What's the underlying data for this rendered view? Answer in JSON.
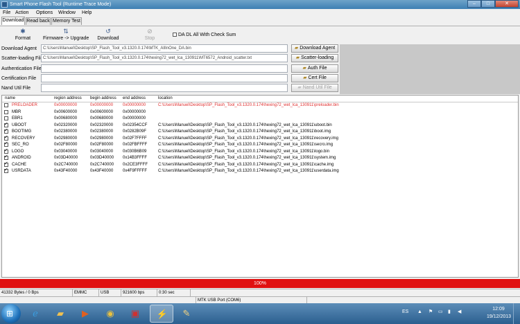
{
  "window": {
    "title": "Smart Phone Flash Tool (Runtime Trace Mode)"
  },
  "menu": [
    "File",
    "Action",
    "Options",
    "Window",
    "Help"
  ],
  "tabs": [
    "Download",
    "Read back",
    "Memory Test"
  ],
  "toolbar": {
    "format": "Format",
    "firmware_upgrade": "Firmware -> Upgrade",
    "download": "Download",
    "stop": "Stop",
    "da_dl_label": "DA DL All With Check Sum"
  },
  "files": [
    {
      "label": "Download Agent",
      "value": "C:\\Users\\Manuel\\Desktop\\SP_Flash_Tool_v3.1320.0.174\\MTK_AllInOne_DA.bin",
      "button": "Download Agent",
      "enabled": true
    },
    {
      "label": "Scatter-loading File",
      "value": "C:\\Users\\Manuel\\Desktop\\SP_Flash_Tool_v3.1320.0.174\\hexing72_wet_lca_130911\\MT6572_Android_scatter.txt",
      "button": "Scatter-loading",
      "enabled": true
    },
    {
      "label": "Authentication File",
      "value": "",
      "button": "Auth File",
      "enabled": true
    },
    {
      "label": "Certification File",
      "value": "",
      "button": "Cert File",
      "enabled": true
    },
    {
      "label": "Nand Util File",
      "value": "",
      "button": "Nand Util File",
      "enabled": false
    }
  ],
  "table": {
    "headers": [
      "name",
      "region address",
      "begin address",
      "end address",
      "location"
    ],
    "rows": [
      {
        "checked": false,
        "name": "PRELOADER",
        "region": "0x00000000",
        "begin": "0x00000000",
        "end": "0x00000000",
        "location": "C:\\Users\\Manuel\\Desktop\\SP_Flash_Tool_v3.1320.0.174\\hexing72_wet_lca_130911\\preloader.bin",
        "highlight": true
      },
      {
        "checked": false,
        "name": "MBR",
        "region": "0x00600000",
        "begin": "0x00600000",
        "end": "0x00000000",
        "location": "",
        "highlight": false
      },
      {
        "checked": false,
        "name": "EBR1",
        "region": "0x00680000",
        "begin": "0x00680000",
        "end": "0x00000000",
        "location": "",
        "highlight": false
      },
      {
        "checked": true,
        "name": "UBOOT",
        "region": "0x02320000",
        "begin": "0x02320000",
        "end": "0x02354CCF",
        "location": "C:\\Users\\Manuel\\Desktop\\SP_Flash_Tool_v3.1320.0.174\\hexing72_wet_lca_130911\\uboot.bin",
        "highlight": false
      },
      {
        "checked": true,
        "name": "BOOTIMG",
        "region": "0x02380000",
        "begin": "0x02380000",
        "end": "0x0282B09F",
        "location": "C:\\Users\\Manuel\\Desktop\\SP_Flash_Tool_v3.1320.0.174\\hexing72_wet_lca_130911\\boot.img",
        "highlight": false
      },
      {
        "checked": true,
        "name": "RECOVERY",
        "region": "0x02980000",
        "begin": "0x02980000",
        "end": "0x02F7FFFF",
        "location": "C:\\Users\\Manuel\\Desktop\\SP_Flash_Tool_v3.1320.0.174\\hexing72_wet_lca_130911\\recovery.img",
        "highlight": false
      },
      {
        "checked": true,
        "name": "SEC_RO",
        "region": "0x02F80000",
        "begin": "0x02F80000",
        "end": "0x02FBFFFF",
        "location": "C:\\Users\\Manuel\\Desktop\\SP_Flash_Tool_v3.1320.0.174\\hexing72_wet_lca_130911\\secro.img",
        "highlight": false
      },
      {
        "checked": true,
        "name": "LOGO",
        "region": "0x03040000",
        "begin": "0x03040000",
        "end": "0x030B6B09",
        "location": "C:\\Users\\Manuel\\Desktop\\SP_Flash_Tool_v3.1320.0.174\\hexing72_wet_lca_130911\\logo.bin",
        "highlight": false
      },
      {
        "checked": true,
        "name": "ANDROID",
        "region": "0x03D40000",
        "begin": "0x03D40000",
        "end": "0x14B3FFFF",
        "location": "C:\\Users\\Manuel\\Desktop\\SP_Flash_Tool_v3.1320.0.174\\hexing72_wet_lca_130911\\system.img",
        "highlight": false
      },
      {
        "checked": true,
        "name": "CACHE",
        "region": "0x2C740000",
        "begin": "0x2C740000",
        "end": "0x2CE3FFFF",
        "location": "C:\\Users\\Manuel\\Desktop\\SP_Flash_Tool_v3.1320.0.174\\hexing72_wet_lca_130911\\cache.img",
        "highlight": false
      },
      {
        "checked": true,
        "name": "USRDATA",
        "region": "0x43F40000",
        "begin": "0x43F40000",
        "end": "0x4F9FFFFF",
        "location": "C:\\Users\\Manuel\\Desktop\\SP_Flash_Tool_v3.1320.0.174\\hexing72_wet_lca_130911\\userdata.img",
        "highlight": false
      }
    ]
  },
  "progress": {
    "percent": 100,
    "label": "100%",
    "color": "#e01010"
  },
  "status": {
    "bytes": "41332 Bytes / 0 Bps",
    "storage": "EMMC",
    "conn": "USB",
    "baud": "921600 bps",
    "time": "0:30 sec",
    "port": "MTK USB Port (COM6)"
  },
  "taskbar": {
    "apps": [
      "ie-icon",
      "folder-icon",
      "media-player-icon",
      "chrome-icon",
      "photo-icon",
      "flash-tool-icon",
      "paint-icon"
    ],
    "lang": "ES",
    "time": "12:09",
    "date": "19/12/2013"
  },
  "colors": {
    "title_bar": "#3d7fb3",
    "taskbar": "#2b5f8f",
    "highlight_row": "#e03030"
  }
}
